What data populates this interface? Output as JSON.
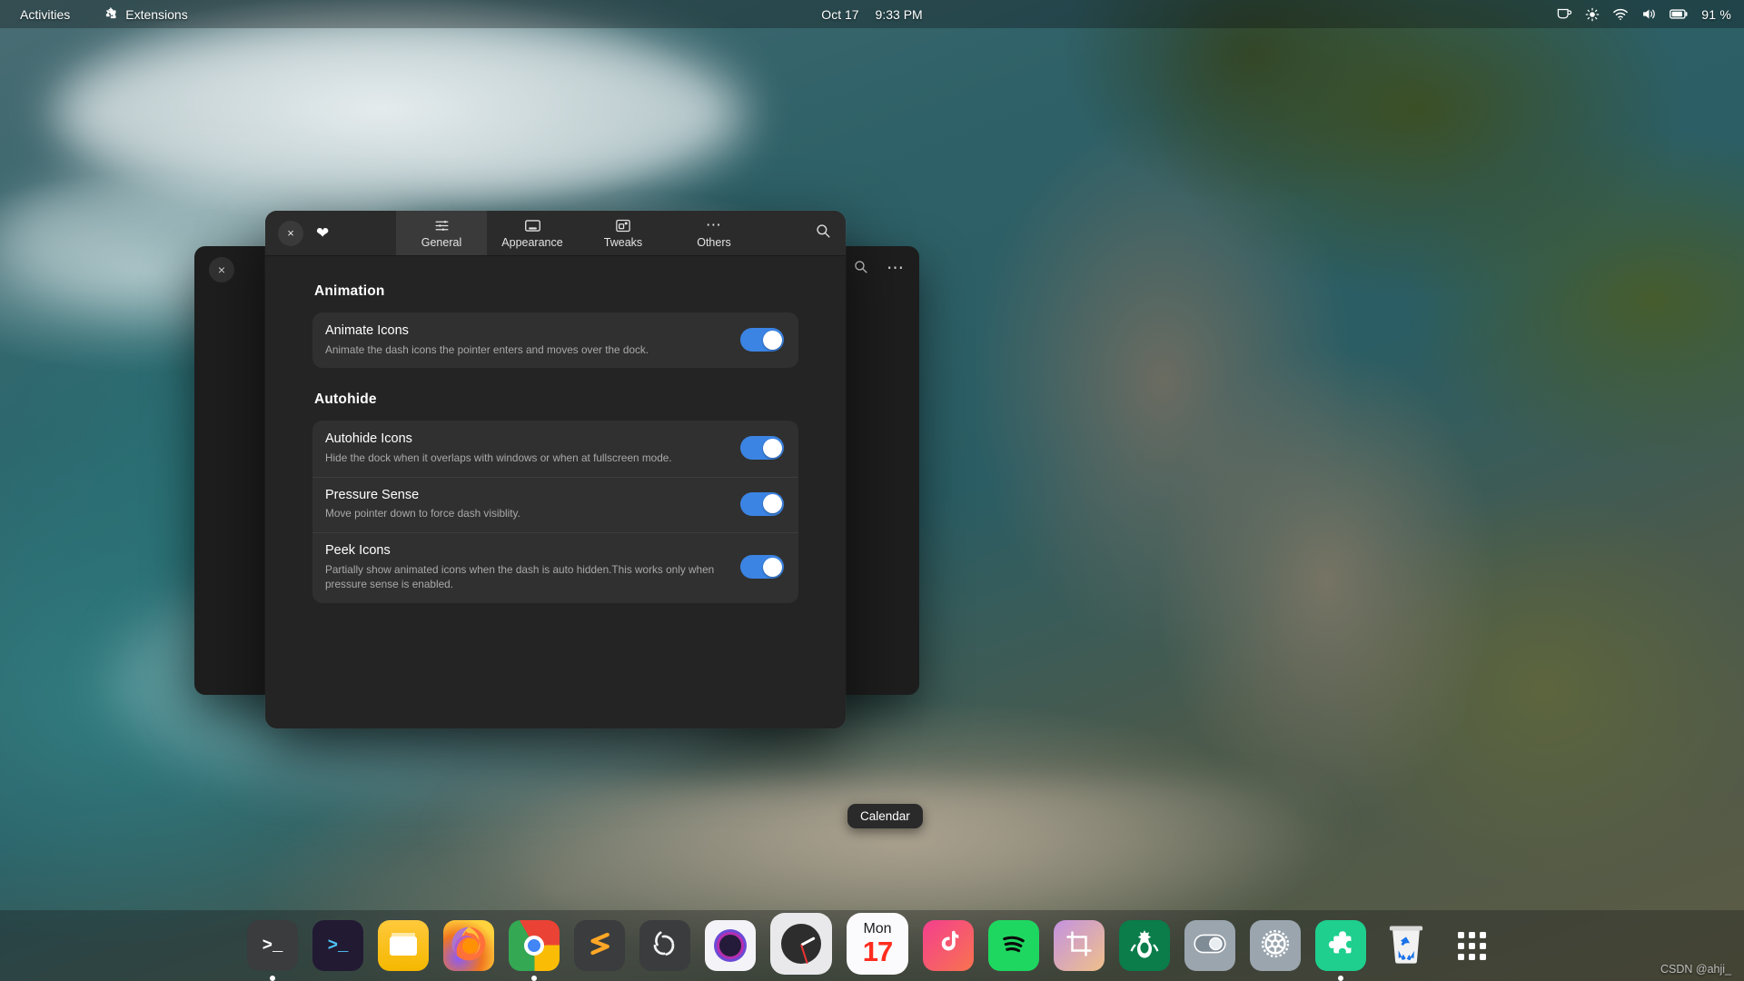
{
  "topbar": {
    "activities_label": "Activities",
    "extensions_label": "Extensions",
    "extensions_icon": "puzzle-icon",
    "clock_date": "Oct 17",
    "clock_time": "9:33 PM",
    "status_icons": [
      "coffee-cup-icon",
      "brightness-icon",
      "wifi-icon",
      "volume-icon",
      "battery-icon"
    ],
    "battery_percent": "91 %"
  },
  "background_window": {
    "close_label": "×",
    "search_icon": "search-icon",
    "menu_icon": "more-options-icon"
  },
  "dialog": {
    "close_label": "×",
    "favorite_icon": "heart-icon",
    "search_icon": "search-icon",
    "tabs": [
      {
        "label": "General",
        "icon": "sliders-icon",
        "active": true
      },
      {
        "label": "Appearance",
        "icon": "window-icon",
        "active": false
      },
      {
        "label": "Tweaks",
        "icon": "tweaks-icon",
        "active": false
      },
      {
        "label": "Others",
        "icon": "ellipsis-icon",
        "active": false
      }
    ],
    "sections": [
      {
        "title": "Animation",
        "rows": [
          {
            "title": "Animate Icons",
            "subtitle": "Animate the dash icons the pointer enters and moves over the dock.",
            "toggle": "on"
          }
        ]
      },
      {
        "title": "Autohide",
        "rows": [
          {
            "title": "Autohide Icons",
            "subtitle": "Hide the dock when it overlaps with windows or when at fullscreen mode.",
            "toggle": "on"
          },
          {
            "title": "Pressure Sense",
            "subtitle": "Move pointer down to force dash visiblity.",
            "toggle": "on"
          },
          {
            "title": "Peek Icons",
            "subtitle": "Partially show animated icons when the dash is auto hidden.This works only when pressure sense is enabled.",
            "toggle": "on"
          }
        ]
      }
    ],
    "accent_color": "#3b84e4"
  },
  "dock": {
    "tooltip": "Calendar",
    "items": [
      {
        "name": "terminal",
        "icon": "terminal-icon",
        "running": true
      },
      {
        "name": "terminal-alt",
        "icon": "terminal-alt-icon",
        "running": false
      },
      {
        "name": "files",
        "icon": "files-icon",
        "running": false
      },
      {
        "name": "firefox",
        "icon": "firefox-icon",
        "running": false
      },
      {
        "name": "chrome",
        "icon": "chrome-icon",
        "running": true
      },
      {
        "name": "sublime-text",
        "icon": "sublime-text-icon",
        "running": false
      },
      {
        "name": "obs-studio",
        "icon": "obs-icon",
        "running": false
      },
      {
        "name": "camera",
        "icon": "camera-icon",
        "running": false
      },
      {
        "name": "clock",
        "icon": "clock-icon",
        "running": false
      },
      {
        "name": "calendar",
        "icon": "calendar-icon",
        "running": false
      },
      {
        "name": "tiktok",
        "icon": "music-note-icon",
        "running": false
      },
      {
        "name": "spotify",
        "icon": "spotify-icon",
        "running": false
      },
      {
        "name": "screenshot",
        "icon": "crop-icon",
        "running": false
      },
      {
        "name": "starbucks",
        "icon": "starbucks-icon",
        "running": false
      },
      {
        "name": "toggle-tool",
        "icon": "toggle-icon",
        "running": false
      },
      {
        "name": "settings",
        "icon": "gear-icon",
        "running": false
      },
      {
        "name": "extensions",
        "icon": "puzzle-icon",
        "running": true
      },
      {
        "name": "trash",
        "icon": "trash-icon",
        "running": false
      },
      {
        "name": "show-apps",
        "icon": "app-grid-icon",
        "running": false
      }
    ],
    "calendar_icon": {
      "dow": "Mon",
      "day": "17"
    }
  },
  "watermark": "CSDN @ahji_"
}
